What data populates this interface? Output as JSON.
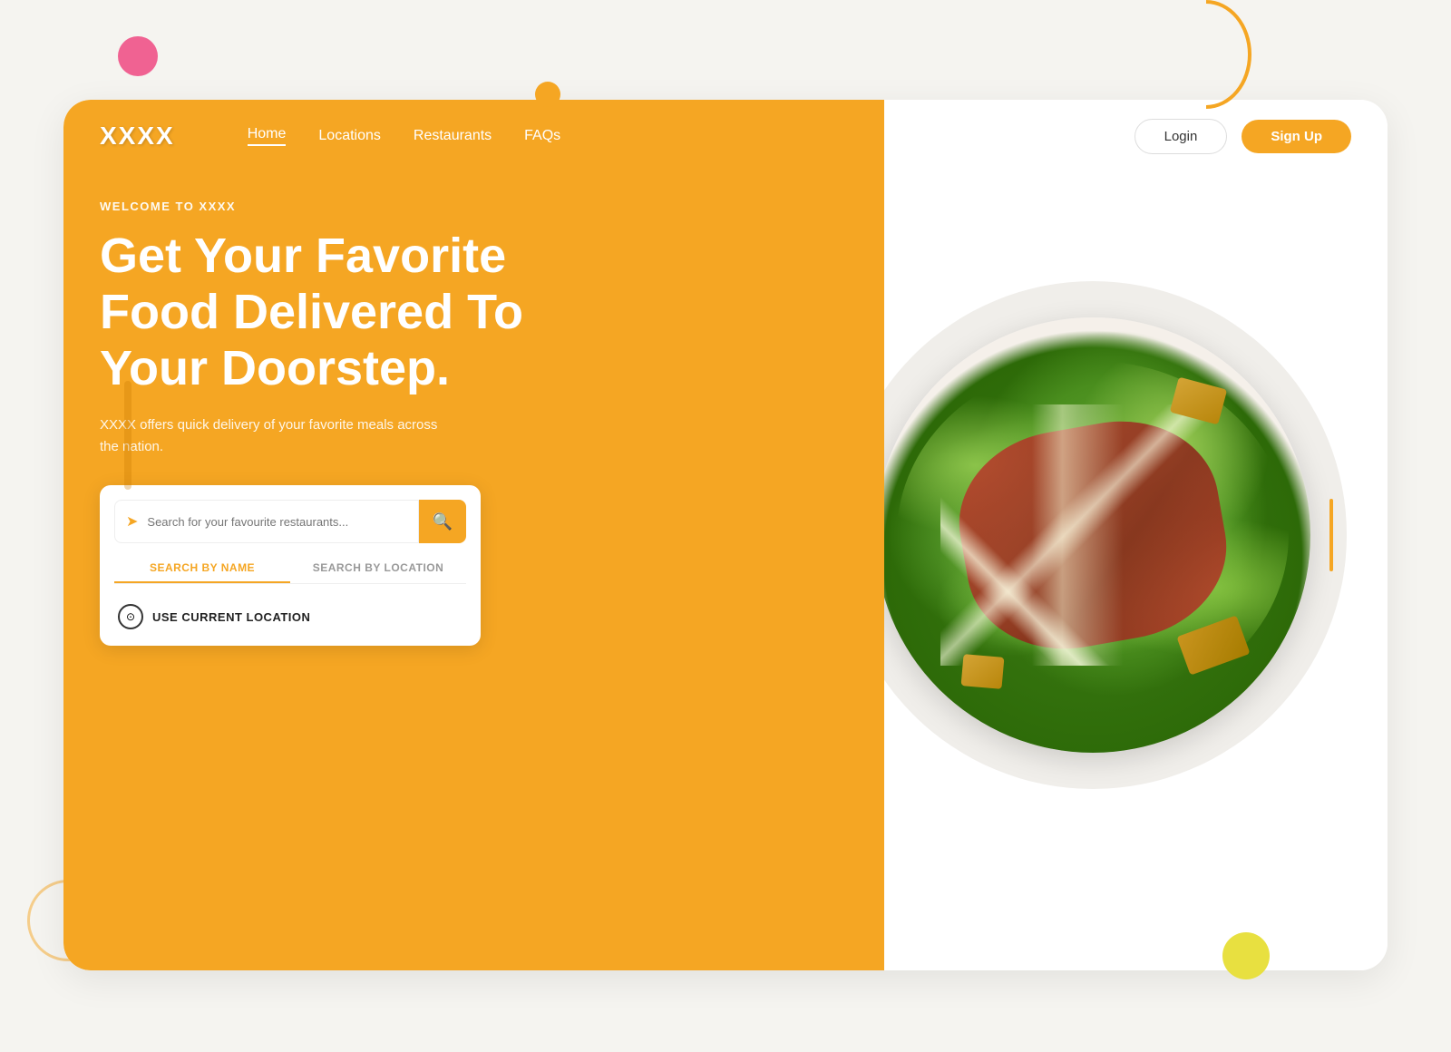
{
  "decorative": {
    "pink_circle": "decorative",
    "orange_arc": "decorative",
    "yellow_circle": "decorative"
  },
  "navbar": {
    "logo": "XXXX",
    "links": [
      {
        "label": "Home",
        "active": true
      },
      {
        "label": "Locations",
        "active": false
      },
      {
        "label": "Restaurants",
        "active": false
      },
      {
        "label": "FAQs",
        "active": false
      }
    ],
    "login_label": "Login",
    "signup_label": "Sign Up"
  },
  "hero": {
    "welcome": "WELCOME TO XXXX",
    "title": "Get Your Favorite Food Delivered To Your Doorstep.",
    "subtitle": "XXXX offers quick delivery of your favorite meals across the nation.",
    "search_placeholder": "Search for your favourite restaurants...",
    "tab_by_name": "SEARCH BY NAME",
    "tab_by_location": "SEARCH BY LOCATION",
    "use_location_label": "USE CURRENT LOCATION"
  }
}
